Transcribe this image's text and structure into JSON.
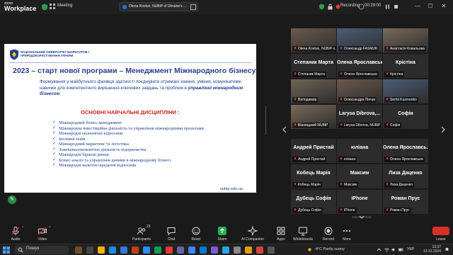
{
  "topbar": {
    "app_name_small": "zoom",
    "app_name": "Workplace",
    "meeting_label": "Meeting",
    "share_label": "Olena Kovtun, NUBiP of Ukraine's ...",
    "recording_label": "Recording",
    "timer": "00:29:00"
  },
  "slide": {
    "university_name": "НАЦІОНАЛЬНИЙ УНІВЕРСИТЕТ БІОРЕСУРСІВ І ПРИРОДОКОРИСТУВАННЯ УКРАЇНИ",
    "title": "2023 – старт нової програми – Менеджмент Міжнародного бізнесу",
    "description": "Формування у майбутнього фахівця здатності поєднувати отримані знання, уміння, комунікативні навички для компетентного вирішення ключових завдань та проблем в",
    "description_highlight": "управлінні міжнародним бізнесом",
    "subtitle": "ОСНОВНІ НАВЧАЛЬНІ ДИСЦИПЛІНИ :",
    "disciplines": [
      "Міжнародний бізнес-менеджмент",
      "Міжнародна інвестиційна діяльність та управління міжнародними проектами",
      "Міжнародні економічні відносини",
      "Іноземні мови",
      "Міжнародний маркетинг та логістика",
      "Зовнішньоекономічна діяльність підприємства",
      "Міжнародні біржові ринки",
      "Бізнес-аналіз та управління даними в міжнародному бізнесі",
      "Міжнародні валютно-кредитні відносини"
    ],
    "url": "nubip.edu.ua"
  },
  "participants": [
    {
      "type": "video",
      "caption": "Olena Kovtun, NUBiP o..."
    },
    {
      "type": "video",
      "caption": "Олександр FASMUK"
    },
    {
      "type": "video",
      "caption": "Анастасія Ковальова"
    },
    {
      "type": "name",
      "big": "Степаник Марта",
      "caption": "Степаник Марта"
    },
    {
      "type": "name",
      "big": "Олена Ярославська",
      "caption": "Олена Ярославська"
    },
    {
      "type": "name",
      "big": "Крістіна",
      "caption": "Крістіна"
    },
    {
      "type": "video",
      "caption": "Володимир"
    },
    {
      "type": "video",
      "caption": "Олександра Пінчук"
    },
    {
      "type": "video",
      "caption": "Serhii Kuzmenko"
    },
    {
      "type": "video",
      "caption": "Вінницький NUBiP"
    },
    {
      "type": "name",
      "big": "Larysa Dibrova,...",
      "caption": "Larysa Dibrova, NUBiP"
    },
    {
      "type": "name",
      "big": "Софія",
      "caption": "Софія"
    },
    {
      "type": "name",
      "big": "Андрей Пристай",
      "caption": "Андрей Пристай"
    },
    {
      "type": "name",
      "big": "юліана",
      "caption": "юліана"
    },
    {
      "type": "name",
      "big": "Олена Ярославсь...",
      "caption": "Олена Ярославська"
    },
    {
      "type": "name",
      "big": "Кобець Марія",
      "caption": "Кобець Марія"
    },
    {
      "type": "name",
      "big": "Максим",
      "caption": "Максим"
    },
    {
      "type": "name",
      "big": "Лиза Даценко",
      "caption": "Лиза Даценко"
    },
    {
      "type": "name",
      "big": "Дубець Софія",
      "caption": "Дубець Софія"
    },
    {
      "type": "name",
      "big": "iPhone",
      "caption": "iPhone"
    },
    {
      "type": "name",
      "big": "Роман Прус",
      "caption": "Роман Прус"
    }
  ],
  "toolbar": {
    "audio": "Audio",
    "video": "Video",
    "participants": "Participants",
    "participants_count": "23",
    "chat": "Chat",
    "react": "React",
    "share": "Share",
    "ai_companion": "AI Companion",
    "apps": "Apps",
    "whiteboards": "Whiteboards",
    "record": "Record",
    "more": "More",
    "leave": "Leave"
  },
  "taskbar": {
    "search_placeholder": "Пошук",
    "weather": "-4°C  Partly sunny",
    "language": "УКР",
    "time": "13:37",
    "date": "13.12.2024"
  },
  "colors": {
    "slide_title": "#1f3f8f",
    "subtitle_red": "#d11f1f",
    "leave_red": "#d93025",
    "toolbar_bg": "#1a1a1a"
  }
}
